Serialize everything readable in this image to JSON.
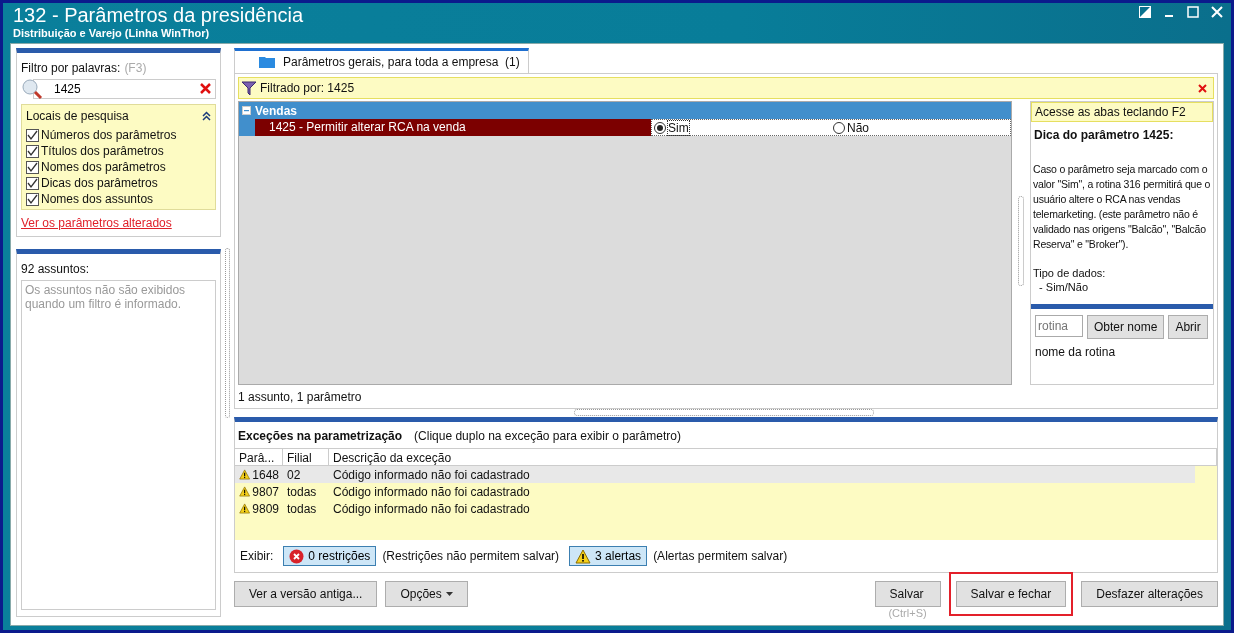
{
  "window": {
    "title": "132 - Parâmetros da presidência",
    "subtitle": "Distribuição e Varejo (Linha WinThor)"
  },
  "filter": {
    "label": "Filtro por palavras:",
    "shortcut": "(F3)",
    "value": "1425"
  },
  "search_locations": {
    "title": "Locais de pesquisa",
    "expanded": true,
    "options": [
      {
        "label": "Números dos parâmetros",
        "checked": true
      },
      {
        "label": "Títulos dos parâmetros",
        "checked": true
      },
      {
        "label": "Nomes dos parâmetros",
        "checked": true
      },
      {
        "label": "Dicas dos parâmetros",
        "checked": true
      },
      {
        "label": "Nomes dos assuntos",
        "checked": true
      }
    ]
  },
  "changed_link": "Ver os parâmetros alterados",
  "subjects": {
    "count_label": "92 assuntos:",
    "message": "Os assuntos não são exibidos quando um filtro é informado."
  },
  "tabs": [
    {
      "label": "Parâmetros gerais, para toda a empresa  (1)",
      "selected": true
    }
  ],
  "filter_bar": "Filtrado por: 1425",
  "groups": [
    {
      "name": "Vendas",
      "expanded": true,
      "params": [
        {
          "label": "1425 - Permitir alterar RCA na venda",
          "selected": true,
          "options": [
            {
              "label": "Sim",
              "selected": true
            },
            {
              "label": "Não",
              "selected": false
            }
          ]
        }
      ]
    }
  ],
  "status": "1 assunto, 1 parâmetro",
  "tip": {
    "hint": "Acesse as abas teclando F2",
    "title": "Dica do parâmetro 1425:",
    "body": "Caso o parâmetro seja marcado com o valor \"Sim\", a rotina 316 permitirá que o usuário altere o RCA nas vendas telemarketing. (este parâmetro não é validado nas origens \"Balcão\", \"Balcão Reserva\" e \"Broker\").",
    "data_type_label": "Tipo de dados:",
    "data_type": "- Sim/Não"
  },
  "routine": {
    "placeholder": "rotina",
    "buttons": [
      "Obter nome",
      "Abrir"
    ],
    "name": "nome da rotina"
  },
  "exceptions": {
    "title": "Exceções na parametrização",
    "hint": "(Clique duplo na exceção para exibir o parâmetro)",
    "columns": [
      "Parâ...",
      "Filial",
      "Descrição da exceção"
    ],
    "rows": [
      {
        "cells": [
          "1648",
          "02",
          "Código informado não foi cadastrado"
        ],
        "selected": true
      },
      {
        "cells": [
          "9807",
          "todas",
          "Código informado não foi cadastrado"
        ],
        "selected": false
      },
      {
        "cells": [
          "9809",
          "todas",
          "Código informado não foi cadastrado"
        ],
        "selected": false
      }
    ],
    "show_label": "Exibir:",
    "restrictions": {
      "label": "0 restrições",
      "note": "(Restrições não permitem salvar)"
    },
    "alerts": {
      "label": "3 alertas",
      "note": "(Alertas permitem salvar)"
    }
  },
  "left_buttons": [
    {
      "label": "Ver a versão antiga...",
      "kind": "plain"
    },
    {
      "label": "Opções",
      "kind": "menu"
    }
  ],
  "right_buttons": [
    {
      "label": "Salvar",
      "shortcut": "(Ctrl+S)",
      "highlighted": false
    },
    {
      "label": "Salvar e fechar",
      "highlighted": true
    },
    {
      "label": "Desfazer alterações",
      "highlighted": false
    }
  ]
}
